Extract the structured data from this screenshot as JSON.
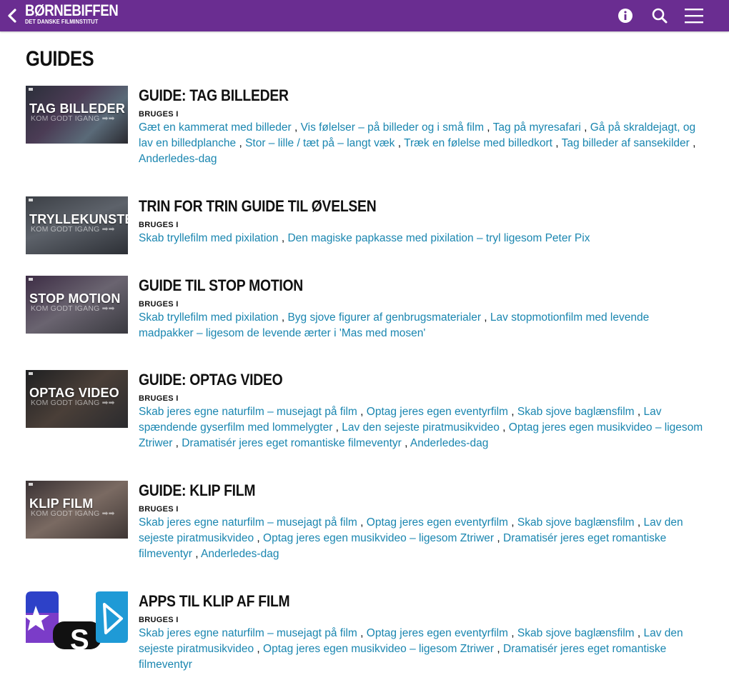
{
  "header": {
    "brand": "BØRNEBIFFEN",
    "brand_sub": "DET DANSKE FILMINSTITUT",
    "icons": [
      "chevron-left-icon",
      "info-icon",
      "search-icon",
      "menu-icon"
    ],
    "color": "#6a2d91"
  },
  "page": {
    "title": "GUIDES"
  },
  "used_label": "BRUGES I",
  "link_color": "#1a86b0",
  "guides": [
    {
      "title": "GUIDE: TAG BILLEDER",
      "thumb_label": "TAG BILLEDER",
      "thumb_sub": "KOM GODT IGANG",
      "links": [
        "Gæt en kammerat med billeder",
        "Vis følelser – på billeder og i små film",
        "Tag på myresafari",
        "Gå på skraldejagt, og lav en billedplanche",
        "Stor – lille / tæt på – langt væk",
        "Træk en følelse med billedkort",
        "Tag billeder af sansekilder",
        "Anderledes-dag"
      ]
    },
    {
      "title": "TRIN FOR TRIN GUIDE TIL ØVELSEN",
      "thumb_label": "TRYLLEKUNSTEREN",
      "thumb_sub": "KOM GODT IGANG",
      "links": [
        "Skab tryllefilm med pixilation",
        "Den magiske papkasse med pixilation – tryl ligesom Peter Pix"
      ]
    },
    {
      "title": "GUIDE TIL STOP MOTION",
      "thumb_label": "STOP MOTION",
      "thumb_sub": "KOM GODT IGANG",
      "links": [
        "Skab tryllefilm med pixilation",
        "Byg sjove figurer af genbrugsmaterialer",
        "Lav stopmotionfilm med levende madpakker – ligesom de levende ærter i 'Mas med mosen'"
      ]
    },
    {
      "title": "GUIDE: OPTAG VIDEO",
      "thumb_label": "OPTAG VIDEO",
      "thumb_sub": "KOM GODT IGANG",
      "links": [
        "Skab jeres egne naturfilm – musejagt på film",
        "Optag jeres egen eventyrfilm",
        "Skab sjove baglænsfilm",
        "Lav spændende gyserfilm med lommelygter",
        "Lav den sejeste piratmusikvideo",
        "Optag jeres egen musikvideo – ligesom Ztriwer",
        "Dramatisér jeres eget romantiske filmeventyr",
        "Anderledes-dag"
      ]
    },
    {
      "title": "GUIDE: KLIP FILM",
      "thumb_label": "KLIP FILM",
      "thumb_sub": "KOM GODT IGANG",
      "links": [
        "Skab jeres egne naturfilm – musejagt på film",
        "Optag jeres egen eventyrfilm",
        "Skab sjove baglænsfilm",
        "Lav den sejeste piratmusikvideo",
        "Optag jeres egen musikvideo – ligesom Ztriwer",
        "Dramatisér jeres eget romantiske filmeventyr",
        "Anderledes-dag"
      ]
    },
    {
      "title": "APPS TIL KLIP AF FILM",
      "thumb_label": "",
      "thumb_sub": "",
      "links": [
        "Skab jeres egne naturfilm – musejagt på film",
        "Optag jeres egen eventyrfilm",
        "Skab sjove baglænsfilm",
        "Lav den sejeste piratmusikvideo",
        "Optag jeres egen musikvideo – ligesom Ztriwer",
        "Dramatisér jeres eget romantiske filmeventyr"
      ]
    }
  ]
}
